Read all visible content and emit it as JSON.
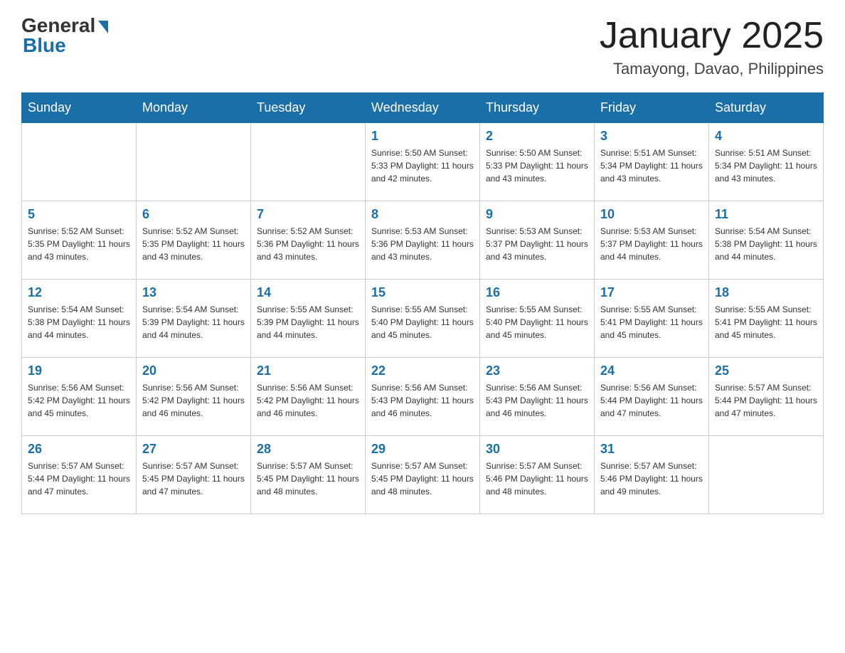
{
  "header": {
    "logo": {
      "general": "General",
      "blue": "Blue"
    },
    "title": "January 2025",
    "location": "Tamayong, Davao, Philippines"
  },
  "days_of_week": [
    "Sunday",
    "Monday",
    "Tuesday",
    "Wednesday",
    "Thursday",
    "Friday",
    "Saturday"
  ],
  "weeks": [
    [
      {
        "day": "",
        "info": ""
      },
      {
        "day": "",
        "info": ""
      },
      {
        "day": "",
        "info": ""
      },
      {
        "day": "1",
        "info": "Sunrise: 5:50 AM\nSunset: 5:33 PM\nDaylight: 11 hours and 42 minutes."
      },
      {
        "day": "2",
        "info": "Sunrise: 5:50 AM\nSunset: 5:33 PM\nDaylight: 11 hours and 43 minutes."
      },
      {
        "day": "3",
        "info": "Sunrise: 5:51 AM\nSunset: 5:34 PM\nDaylight: 11 hours and 43 minutes."
      },
      {
        "day": "4",
        "info": "Sunrise: 5:51 AM\nSunset: 5:34 PM\nDaylight: 11 hours and 43 minutes."
      }
    ],
    [
      {
        "day": "5",
        "info": "Sunrise: 5:52 AM\nSunset: 5:35 PM\nDaylight: 11 hours and 43 minutes."
      },
      {
        "day": "6",
        "info": "Sunrise: 5:52 AM\nSunset: 5:35 PM\nDaylight: 11 hours and 43 minutes."
      },
      {
        "day": "7",
        "info": "Sunrise: 5:52 AM\nSunset: 5:36 PM\nDaylight: 11 hours and 43 minutes."
      },
      {
        "day": "8",
        "info": "Sunrise: 5:53 AM\nSunset: 5:36 PM\nDaylight: 11 hours and 43 minutes."
      },
      {
        "day": "9",
        "info": "Sunrise: 5:53 AM\nSunset: 5:37 PM\nDaylight: 11 hours and 43 minutes."
      },
      {
        "day": "10",
        "info": "Sunrise: 5:53 AM\nSunset: 5:37 PM\nDaylight: 11 hours and 44 minutes."
      },
      {
        "day": "11",
        "info": "Sunrise: 5:54 AM\nSunset: 5:38 PM\nDaylight: 11 hours and 44 minutes."
      }
    ],
    [
      {
        "day": "12",
        "info": "Sunrise: 5:54 AM\nSunset: 5:38 PM\nDaylight: 11 hours and 44 minutes."
      },
      {
        "day": "13",
        "info": "Sunrise: 5:54 AM\nSunset: 5:39 PM\nDaylight: 11 hours and 44 minutes."
      },
      {
        "day": "14",
        "info": "Sunrise: 5:55 AM\nSunset: 5:39 PM\nDaylight: 11 hours and 44 minutes."
      },
      {
        "day": "15",
        "info": "Sunrise: 5:55 AM\nSunset: 5:40 PM\nDaylight: 11 hours and 45 minutes."
      },
      {
        "day": "16",
        "info": "Sunrise: 5:55 AM\nSunset: 5:40 PM\nDaylight: 11 hours and 45 minutes."
      },
      {
        "day": "17",
        "info": "Sunrise: 5:55 AM\nSunset: 5:41 PM\nDaylight: 11 hours and 45 minutes."
      },
      {
        "day": "18",
        "info": "Sunrise: 5:55 AM\nSunset: 5:41 PM\nDaylight: 11 hours and 45 minutes."
      }
    ],
    [
      {
        "day": "19",
        "info": "Sunrise: 5:56 AM\nSunset: 5:42 PM\nDaylight: 11 hours and 45 minutes."
      },
      {
        "day": "20",
        "info": "Sunrise: 5:56 AM\nSunset: 5:42 PM\nDaylight: 11 hours and 46 minutes."
      },
      {
        "day": "21",
        "info": "Sunrise: 5:56 AM\nSunset: 5:42 PM\nDaylight: 11 hours and 46 minutes."
      },
      {
        "day": "22",
        "info": "Sunrise: 5:56 AM\nSunset: 5:43 PM\nDaylight: 11 hours and 46 minutes."
      },
      {
        "day": "23",
        "info": "Sunrise: 5:56 AM\nSunset: 5:43 PM\nDaylight: 11 hours and 46 minutes."
      },
      {
        "day": "24",
        "info": "Sunrise: 5:56 AM\nSunset: 5:44 PM\nDaylight: 11 hours and 47 minutes."
      },
      {
        "day": "25",
        "info": "Sunrise: 5:57 AM\nSunset: 5:44 PM\nDaylight: 11 hours and 47 minutes."
      }
    ],
    [
      {
        "day": "26",
        "info": "Sunrise: 5:57 AM\nSunset: 5:44 PM\nDaylight: 11 hours and 47 minutes."
      },
      {
        "day": "27",
        "info": "Sunrise: 5:57 AM\nSunset: 5:45 PM\nDaylight: 11 hours and 47 minutes."
      },
      {
        "day": "28",
        "info": "Sunrise: 5:57 AM\nSunset: 5:45 PM\nDaylight: 11 hours and 48 minutes."
      },
      {
        "day": "29",
        "info": "Sunrise: 5:57 AM\nSunset: 5:45 PM\nDaylight: 11 hours and 48 minutes."
      },
      {
        "day": "30",
        "info": "Sunrise: 5:57 AM\nSunset: 5:46 PM\nDaylight: 11 hours and 48 minutes."
      },
      {
        "day": "31",
        "info": "Sunrise: 5:57 AM\nSunset: 5:46 PM\nDaylight: 11 hours and 49 minutes."
      },
      {
        "day": "",
        "info": ""
      }
    ]
  ]
}
